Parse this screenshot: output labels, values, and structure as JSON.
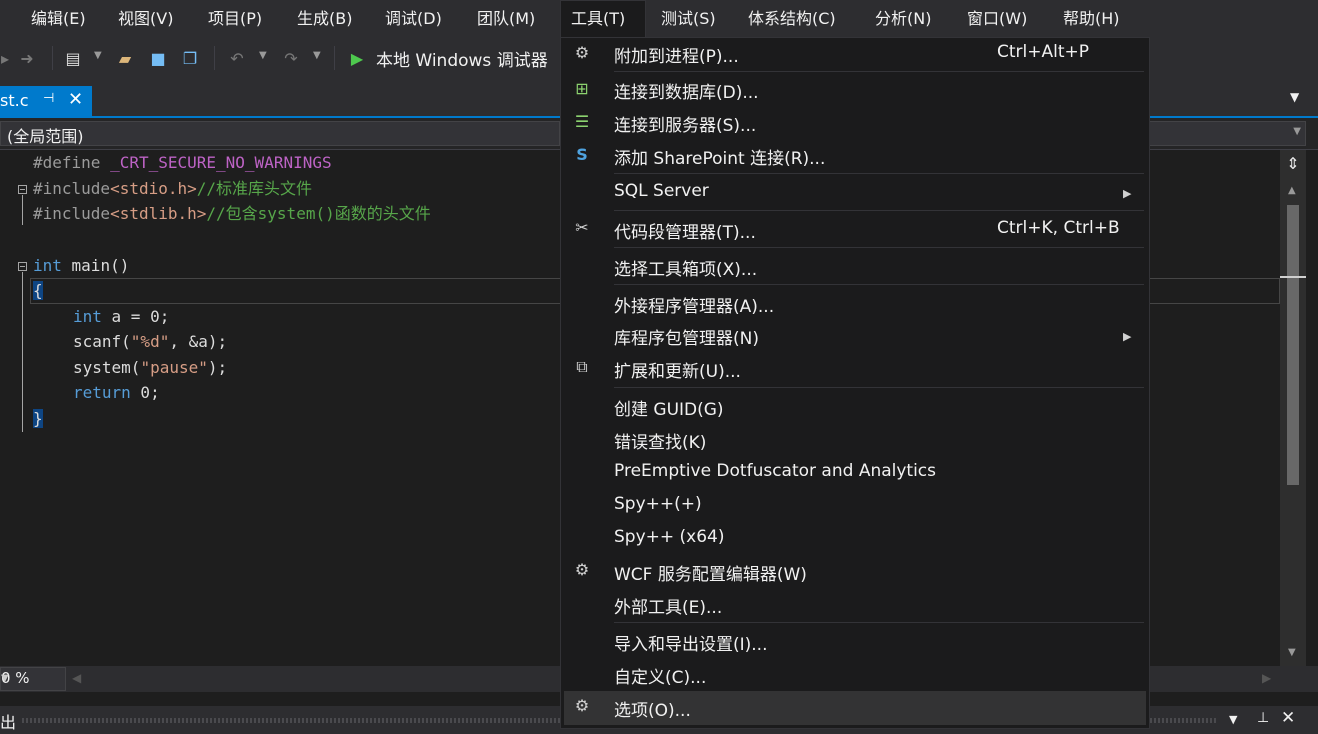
{
  "menubar": {
    "items": [
      "编辑(E)",
      "视图(V)",
      "项目(P)",
      "生成(B)",
      "调试(D)",
      "团队(M)",
      "工具(T)",
      "测试(S)",
      "体系结构(C)",
      "分析(N)",
      "窗口(W)",
      "帮助(H)"
    ]
  },
  "toolbar": {
    "run_label": "本地 Windows 调试器"
  },
  "tab": {
    "label": "st.c",
    "pin": "⊣",
    "close": "✕"
  },
  "scope": {
    "label": "(全局范围)"
  },
  "code": {
    "l1_pp": "#define ",
    "l1_mac": "_CRT_SECURE_NO_WARNINGS",
    "l2_pp": "#include",
    "l2_str": "<stdio.h>",
    "l2_cmt": "//标准库头文件",
    "l3_pp": "#include",
    "l3_str": "<stdlib.h>",
    "l3_cmt": "//包含system()函数的头文件",
    "l5_kw": "int",
    "l5_rest": " main()",
    "l6_brace": "{",
    "l7_kw": "int",
    "l7_rest": " a = 0;",
    "l8_a": "scanf(",
    "l8_str": "\"%d\"",
    "l8_b": ", &a);",
    "l9_a": "system(",
    "l9_str": "\"pause\"",
    "l9_b": ");",
    "l10_kw": "return",
    "l10_rest": " 0;",
    "l11_brace": "}"
  },
  "zoom": {
    "value": "0 %"
  },
  "output": {
    "title": "出"
  },
  "tools_menu": {
    "items": [
      {
        "label": "附加到进程(P)...",
        "shortcut": "Ctrl+Alt+P",
        "icon": "attach-process-icon"
      },
      {
        "label": "连接到数据库(D)...",
        "icon": "connect-database-icon"
      },
      {
        "label": "连接到服务器(S)...",
        "icon": "connect-server-icon"
      },
      {
        "label": "添加 SharePoint 连接(R)...",
        "icon": "sharepoint-icon"
      },
      {
        "label": "SQL Server",
        "submenu": true
      },
      {
        "label": "代码段管理器(T)...",
        "shortcut": "Ctrl+K, Ctrl+B",
        "icon": "snippet-icon"
      },
      {
        "label": "选择工具箱项(X)..."
      },
      {
        "label": "外接程序管理器(A)..."
      },
      {
        "label": "库程序包管理器(N)",
        "submenu": true
      },
      {
        "label": "扩展和更新(U)...",
        "icon": "extensions-icon"
      },
      {
        "label": "创建 GUID(G)"
      },
      {
        "label": "错误查找(K)"
      },
      {
        "label": "PreEmptive Dotfuscator and Analytics"
      },
      {
        "label": "Spy++(+)"
      },
      {
        "label": "Spy++ (x64)"
      },
      {
        "label": "WCF 服务配置编辑器(W)",
        "icon": "wcf-gear-icon"
      },
      {
        "label": "外部工具(E)..."
      },
      {
        "label": "导入和导出设置(I)..."
      },
      {
        "label": "自定义(C)..."
      },
      {
        "label": "选项(O)...",
        "icon": "options-gear-icon",
        "highlighted": true
      }
    ]
  },
  "colors": {
    "accent": "#007acc",
    "menu_bg": "#1b1b1c",
    "editor_bg": "#1e1e1e",
    "highlight": "#333334"
  }
}
